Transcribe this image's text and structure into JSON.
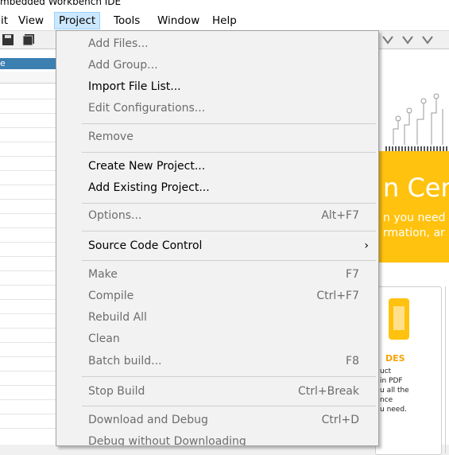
{
  "window": {
    "title": "mbedded Workbench IDE"
  },
  "menubar": {
    "items": [
      {
        "label": "it"
      },
      {
        "label": "View"
      },
      {
        "label": "Project"
      },
      {
        "label": "Tools"
      },
      {
        "label": "Window"
      },
      {
        "label": "Help"
      }
    ]
  },
  "left_panel": {
    "header": "e"
  },
  "project_menu": {
    "items": [
      {
        "label": "Add Files...",
        "shortcut": "",
        "enabled": false
      },
      {
        "label": "Add Group...",
        "shortcut": "",
        "enabled": false
      },
      {
        "label": "Import File List...",
        "shortcut": "",
        "enabled": true
      },
      {
        "label": "Edit Configurations...",
        "shortcut": "",
        "enabled": false
      },
      {
        "label": "Remove",
        "shortcut": "",
        "enabled": false
      },
      {
        "label": "Create New Project...",
        "shortcut": "",
        "enabled": true
      },
      {
        "label": "Add Existing Project...",
        "shortcut": "",
        "enabled": true
      },
      {
        "label": "Options...",
        "shortcut": "Alt+F7",
        "enabled": false
      },
      {
        "label": "Source Code Control",
        "shortcut": "",
        "submenu_arrow": "›",
        "enabled": true
      },
      {
        "label": "Make",
        "shortcut": "F7",
        "enabled": false
      },
      {
        "label": "Compile",
        "shortcut": "Ctrl+F7",
        "enabled": false
      },
      {
        "label": "Rebuild All",
        "shortcut": "",
        "enabled": false
      },
      {
        "label": "Clean",
        "shortcut": "",
        "enabled": false
      },
      {
        "label": "Batch build...",
        "shortcut": "F8",
        "enabled": false
      },
      {
        "label": "Stop Build",
        "shortcut": "Ctrl+Break",
        "enabled": false
      },
      {
        "label": "Download and Debug",
        "shortcut": "Ctrl+D",
        "enabled": false
      },
      {
        "label": "Debug without Downloading",
        "shortcut": "",
        "enabled": false
      }
    ]
  },
  "info_center": {
    "banner_title": "n Cen",
    "banner_line1": "n you need",
    "banner_line2": "rmation, ar",
    "card_title": "DES",
    "card_lines": [
      "uct",
      "in PDF",
      "u all the",
      "nce",
      "u need."
    ]
  },
  "colors": {
    "menu_active_bg": "#cce8ff",
    "banner_yellow": "#ffc20e",
    "panel_header_blue": "#3c7fb1"
  }
}
